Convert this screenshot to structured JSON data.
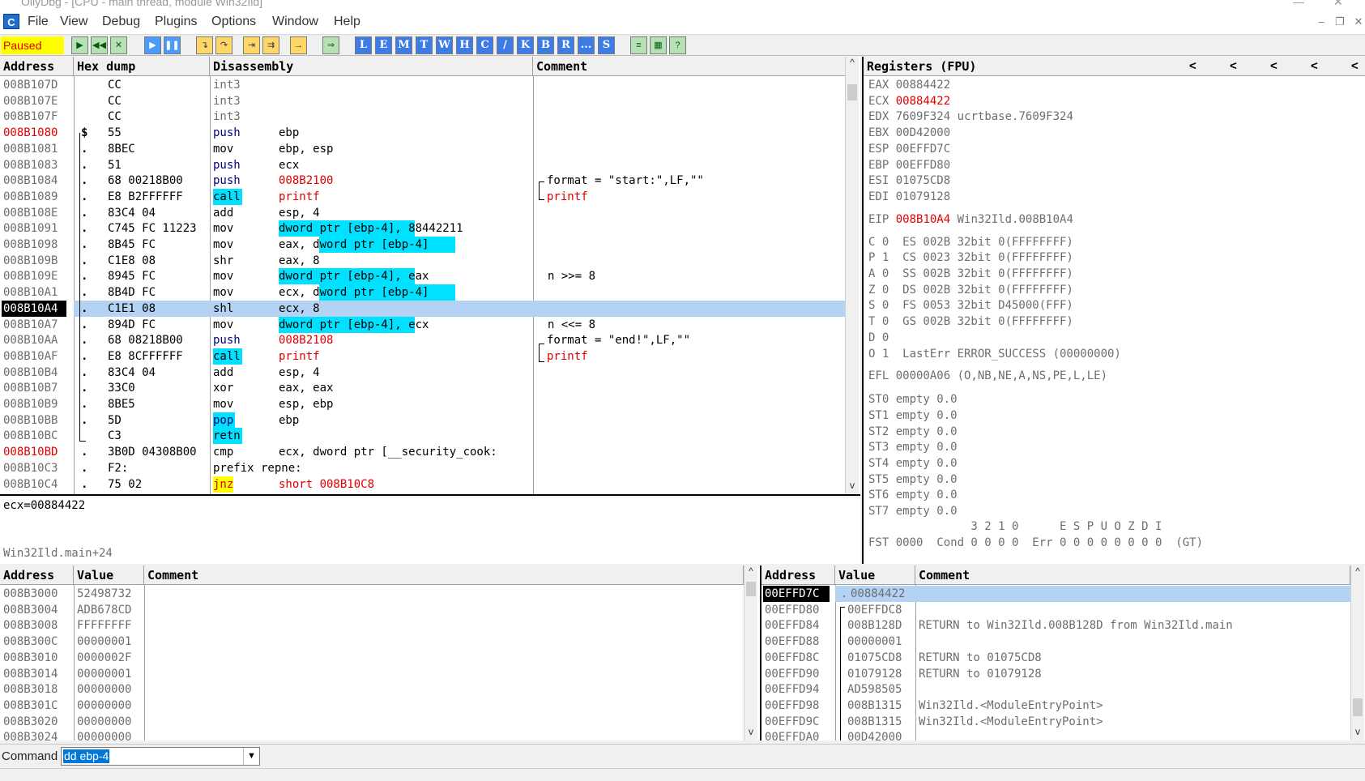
{
  "window": {
    "title": "OllyDbg - [CPU - main thread, module Win32Ild]"
  },
  "menu": [
    "File",
    "View",
    "Debug",
    "Plugins",
    "Options",
    "Window",
    "Help"
  ],
  "toolbar": {
    "status": "Paused",
    "letter_buttons": [
      "L",
      "E",
      "M",
      "T",
      "W",
      "H",
      "C",
      "/",
      "K",
      "B",
      "R",
      "...",
      "S"
    ]
  },
  "disasm": {
    "headers": {
      "address": "Address",
      "hex": "Hex dump",
      "disasm": "Disassembly",
      "comment": "Comment"
    },
    "rows": [
      {
        "addr": "008B107D",
        "mark": "",
        "hex": "CC",
        "mnem": "int3",
        "ops": "",
        "comment": ""
      },
      {
        "addr": "008B107E",
        "mark": "",
        "hex": "CC",
        "mnem": "int3",
        "ops": "",
        "comment": ""
      },
      {
        "addr": "008B107F",
        "mark": "",
        "hex": "CC",
        "mnem": "int3",
        "ops": "",
        "comment": ""
      },
      {
        "addr": "008B1080",
        "mark": "$",
        "hex": "55",
        "mnem": "push",
        "ops": "ebp",
        "comment": ""
      },
      {
        "addr": "008B1081",
        "mark": ".",
        "hex": "8BEC",
        "mnem": "mov",
        "ops": "ebp, esp",
        "comment": ""
      },
      {
        "addr": "008B1083",
        "mark": ".",
        "hex": "51",
        "mnem": "push",
        "ops": "ecx",
        "comment": ""
      },
      {
        "addr": "008B1084",
        "mark": ".",
        "hex": "68 00218B00",
        "mnem": "push",
        "ops": "008B2100",
        "comment": "format = \"start:\",LF,\"\""
      },
      {
        "addr": "008B1089",
        "mark": ".",
        "hex": "E8 B2FFFFFF",
        "mnem": "call",
        "ops": "printf",
        "comment": "printf"
      },
      {
        "addr": "008B108E",
        "mark": ".",
        "hex": "83C4 04",
        "mnem": "add",
        "ops": "esp, 4",
        "comment": ""
      },
      {
        "addr": "008B1091",
        "mark": ".",
        "hex": "C745 FC 11223",
        "mnem": "mov",
        "ops": "dword ptr [ebp-4], 88442211",
        "comment": ""
      },
      {
        "addr": "008B1098",
        "mark": ".",
        "hex": "8B45 FC",
        "mnem": "mov",
        "ops": "eax, dword ptr [ebp-4]",
        "comment": ""
      },
      {
        "addr": "008B109B",
        "mark": ".",
        "hex": "C1E8 08",
        "mnem": "shr",
        "ops": "eax, 8",
        "comment": ""
      },
      {
        "addr": "008B109E",
        "mark": ".",
        "hex": "8945 FC",
        "mnem": "mov",
        "ops": "dword ptr [ebp-4], eax",
        "comment": "n >>= 8"
      },
      {
        "addr": "008B10A1",
        "mark": ".",
        "hex": "8B4D FC",
        "mnem": "mov",
        "ops": "ecx, dword ptr [ebp-4]",
        "comment": ""
      },
      {
        "addr": "008B10A4",
        "mark": ".",
        "hex": "C1E1 08",
        "mnem": "shl",
        "ops": "ecx, 8",
        "comment": ""
      },
      {
        "addr": "008B10A7",
        "mark": ".",
        "hex": "894D FC",
        "mnem": "mov",
        "ops": "dword ptr [ebp-4], ecx",
        "comment": "n <<= 8"
      },
      {
        "addr": "008B10AA",
        "mark": ".",
        "hex": "68 08218B00",
        "mnem": "push",
        "ops": "008B2108",
        "comment": "format = \"end!\",LF,\"\""
      },
      {
        "addr": "008B10AF",
        "mark": ".",
        "hex": "E8 8CFFFFFF",
        "mnem": "call",
        "ops": "printf",
        "comment": "printf"
      },
      {
        "addr": "008B10B4",
        "mark": ".",
        "hex": "83C4 04",
        "mnem": "add",
        "ops": "esp, 4",
        "comment": ""
      },
      {
        "addr": "008B10B7",
        "mark": ".",
        "hex": "33C0",
        "mnem": "xor",
        "ops": "eax, eax",
        "comment": ""
      },
      {
        "addr": "008B10B9",
        "mark": ".",
        "hex": "8BE5",
        "mnem": "mov",
        "ops": "esp, ebp",
        "comment": ""
      },
      {
        "addr": "008B10BB",
        "mark": ".",
        "hex": "5D",
        "mnem": "pop",
        "ops": "ebp",
        "comment": ""
      },
      {
        "addr": "008B10BC",
        "mark": "",
        "hex": "C3",
        "mnem": "retn",
        "ops": "",
        "comment": ""
      },
      {
        "addr": "008B10BD",
        "mark": ".",
        "hex": "3B0D 04308B00",
        "mnem": "cmp",
        "ops": "ecx, dword ptr [__security_cook:",
        "comment": ""
      },
      {
        "addr": "008B10C3",
        "mark": ".",
        "hex": "F2:",
        "mnem": "prefix repne:",
        "ops": "",
        "comment": ""
      },
      {
        "addr": "008B10C4",
        "mark": ".",
        "hex": "75 02",
        "mnem": "jnz",
        "ops": "short 008B10C8",
        "comment": ""
      }
    ],
    "info_line1": "ecx=00884422",
    "info_line2": "Win32Ild.main+24"
  },
  "registers": {
    "header": "Registers (FPU)",
    "lines": [
      {
        "name": "EAX",
        "value": "00884422",
        "extra": "",
        "red": false
      },
      {
        "name": "ECX",
        "value": "00884422",
        "extra": "",
        "red": true
      },
      {
        "name": "EDX",
        "value": "7609F324",
        "extra": "ucrtbase.7609F324",
        "red": false
      },
      {
        "name": "EBX",
        "value": "00D42000",
        "extra": "",
        "red": false
      },
      {
        "name": "ESP",
        "value": "00EFFD7C",
        "extra": "",
        "red": false
      },
      {
        "name": "EBP",
        "value": "00EFFD80",
        "extra": "",
        "red": false
      },
      {
        "name": "ESI",
        "value": "01075CD8",
        "extra": "",
        "red": false
      },
      {
        "name": "EDI",
        "value": "01079128",
        "extra": "",
        "red": false
      }
    ],
    "eip": {
      "name": "EIP",
      "value": "008B10A4",
      "extra": "Win32Ild.008B10A4"
    },
    "flags": [
      "C 0  ES 002B 32bit 0(FFFFFFFF)",
      "P 1  CS 0023 32bit 0(FFFFFFFF)",
      "A 0  SS 002B 32bit 0(FFFFFFFF)",
      "Z 0  DS 002B 32bit 0(FFFFFFFF)",
      "S 0  FS 0053 32bit D45000(FFF)",
      "T 0  GS 002B 32bit 0(FFFFFFFF)",
      "D 0",
      "O 1  LastErr ERROR_SUCCESS (00000000)"
    ],
    "efl": "EFL 00000A06 (O,NB,NE,A,NS,PE,L,LE)",
    "fpu": [
      "ST0 empty 0.0",
      "ST1 empty 0.0",
      "ST2 empty 0.0",
      "ST3 empty 0.0",
      "ST4 empty 0.0",
      "ST5 empty 0.0",
      "ST6 empty 0.0",
      "ST7 empty 0.0"
    ],
    "fst_header": "               3 2 1 0      E S P U O Z D I",
    "fst": "FST 0000  Cond 0 0 0 0  Err 0 0 0 0 0 0 0 0  (GT)"
  },
  "dump": {
    "headers": {
      "address": "Address",
      "value": "Value",
      "comment": "Comment"
    },
    "rows": [
      {
        "addr": "008B3000",
        "value": "52498732"
      },
      {
        "addr": "008B3004",
        "value": "ADB678CD"
      },
      {
        "addr": "008B3008",
        "value": "FFFFFFFF"
      },
      {
        "addr": "008B300C",
        "value": "00000001"
      },
      {
        "addr": "008B3010",
        "value": "0000002F"
      },
      {
        "addr": "008B3014",
        "value": "00000001"
      },
      {
        "addr": "008B3018",
        "value": "00000000"
      },
      {
        "addr": "008B301C",
        "value": "00000000"
      },
      {
        "addr": "008B3020",
        "value": "00000000"
      },
      {
        "addr": "008B3024",
        "value": "00000000"
      }
    ]
  },
  "stack": {
    "headers": {
      "address": "Address",
      "value": "Value",
      "comment": "Comment"
    },
    "rows": [
      {
        "addr": "00EFFD7C",
        "value": "00884422",
        "comment": ""
      },
      {
        "addr": "00EFFD80",
        "value": "00EFFDC8",
        "comment": ""
      },
      {
        "addr": "00EFFD84",
        "value": "008B128D",
        "comment": "RETURN to Win32Ild.008B128D from Win32Ild.main"
      },
      {
        "addr": "00EFFD88",
        "value": "00000001",
        "comment": ""
      },
      {
        "addr": "00EFFD8C",
        "value": "01075CD8",
        "comment": "RETURN to 01075CD8"
      },
      {
        "addr": "00EFFD90",
        "value": "01079128",
        "comment": "RETURN to 01079128"
      },
      {
        "addr": "00EFFD94",
        "value": "AD598505",
        "comment": ""
      },
      {
        "addr": "00EFFD98",
        "value": "008B1315",
        "comment": "Win32Ild.<ModuleEntryPoint>"
      },
      {
        "addr": "00EFFD9C",
        "value": "008B1315",
        "comment": "Win32Ild.<ModuleEntryPoint>"
      },
      {
        "addr": "00EFFDA0",
        "value": "00D42000",
        "comment": ""
      }
    ]
  },
  "command": {
    "label": "Command",
    "value": "dd ebp-4"
  }
}
